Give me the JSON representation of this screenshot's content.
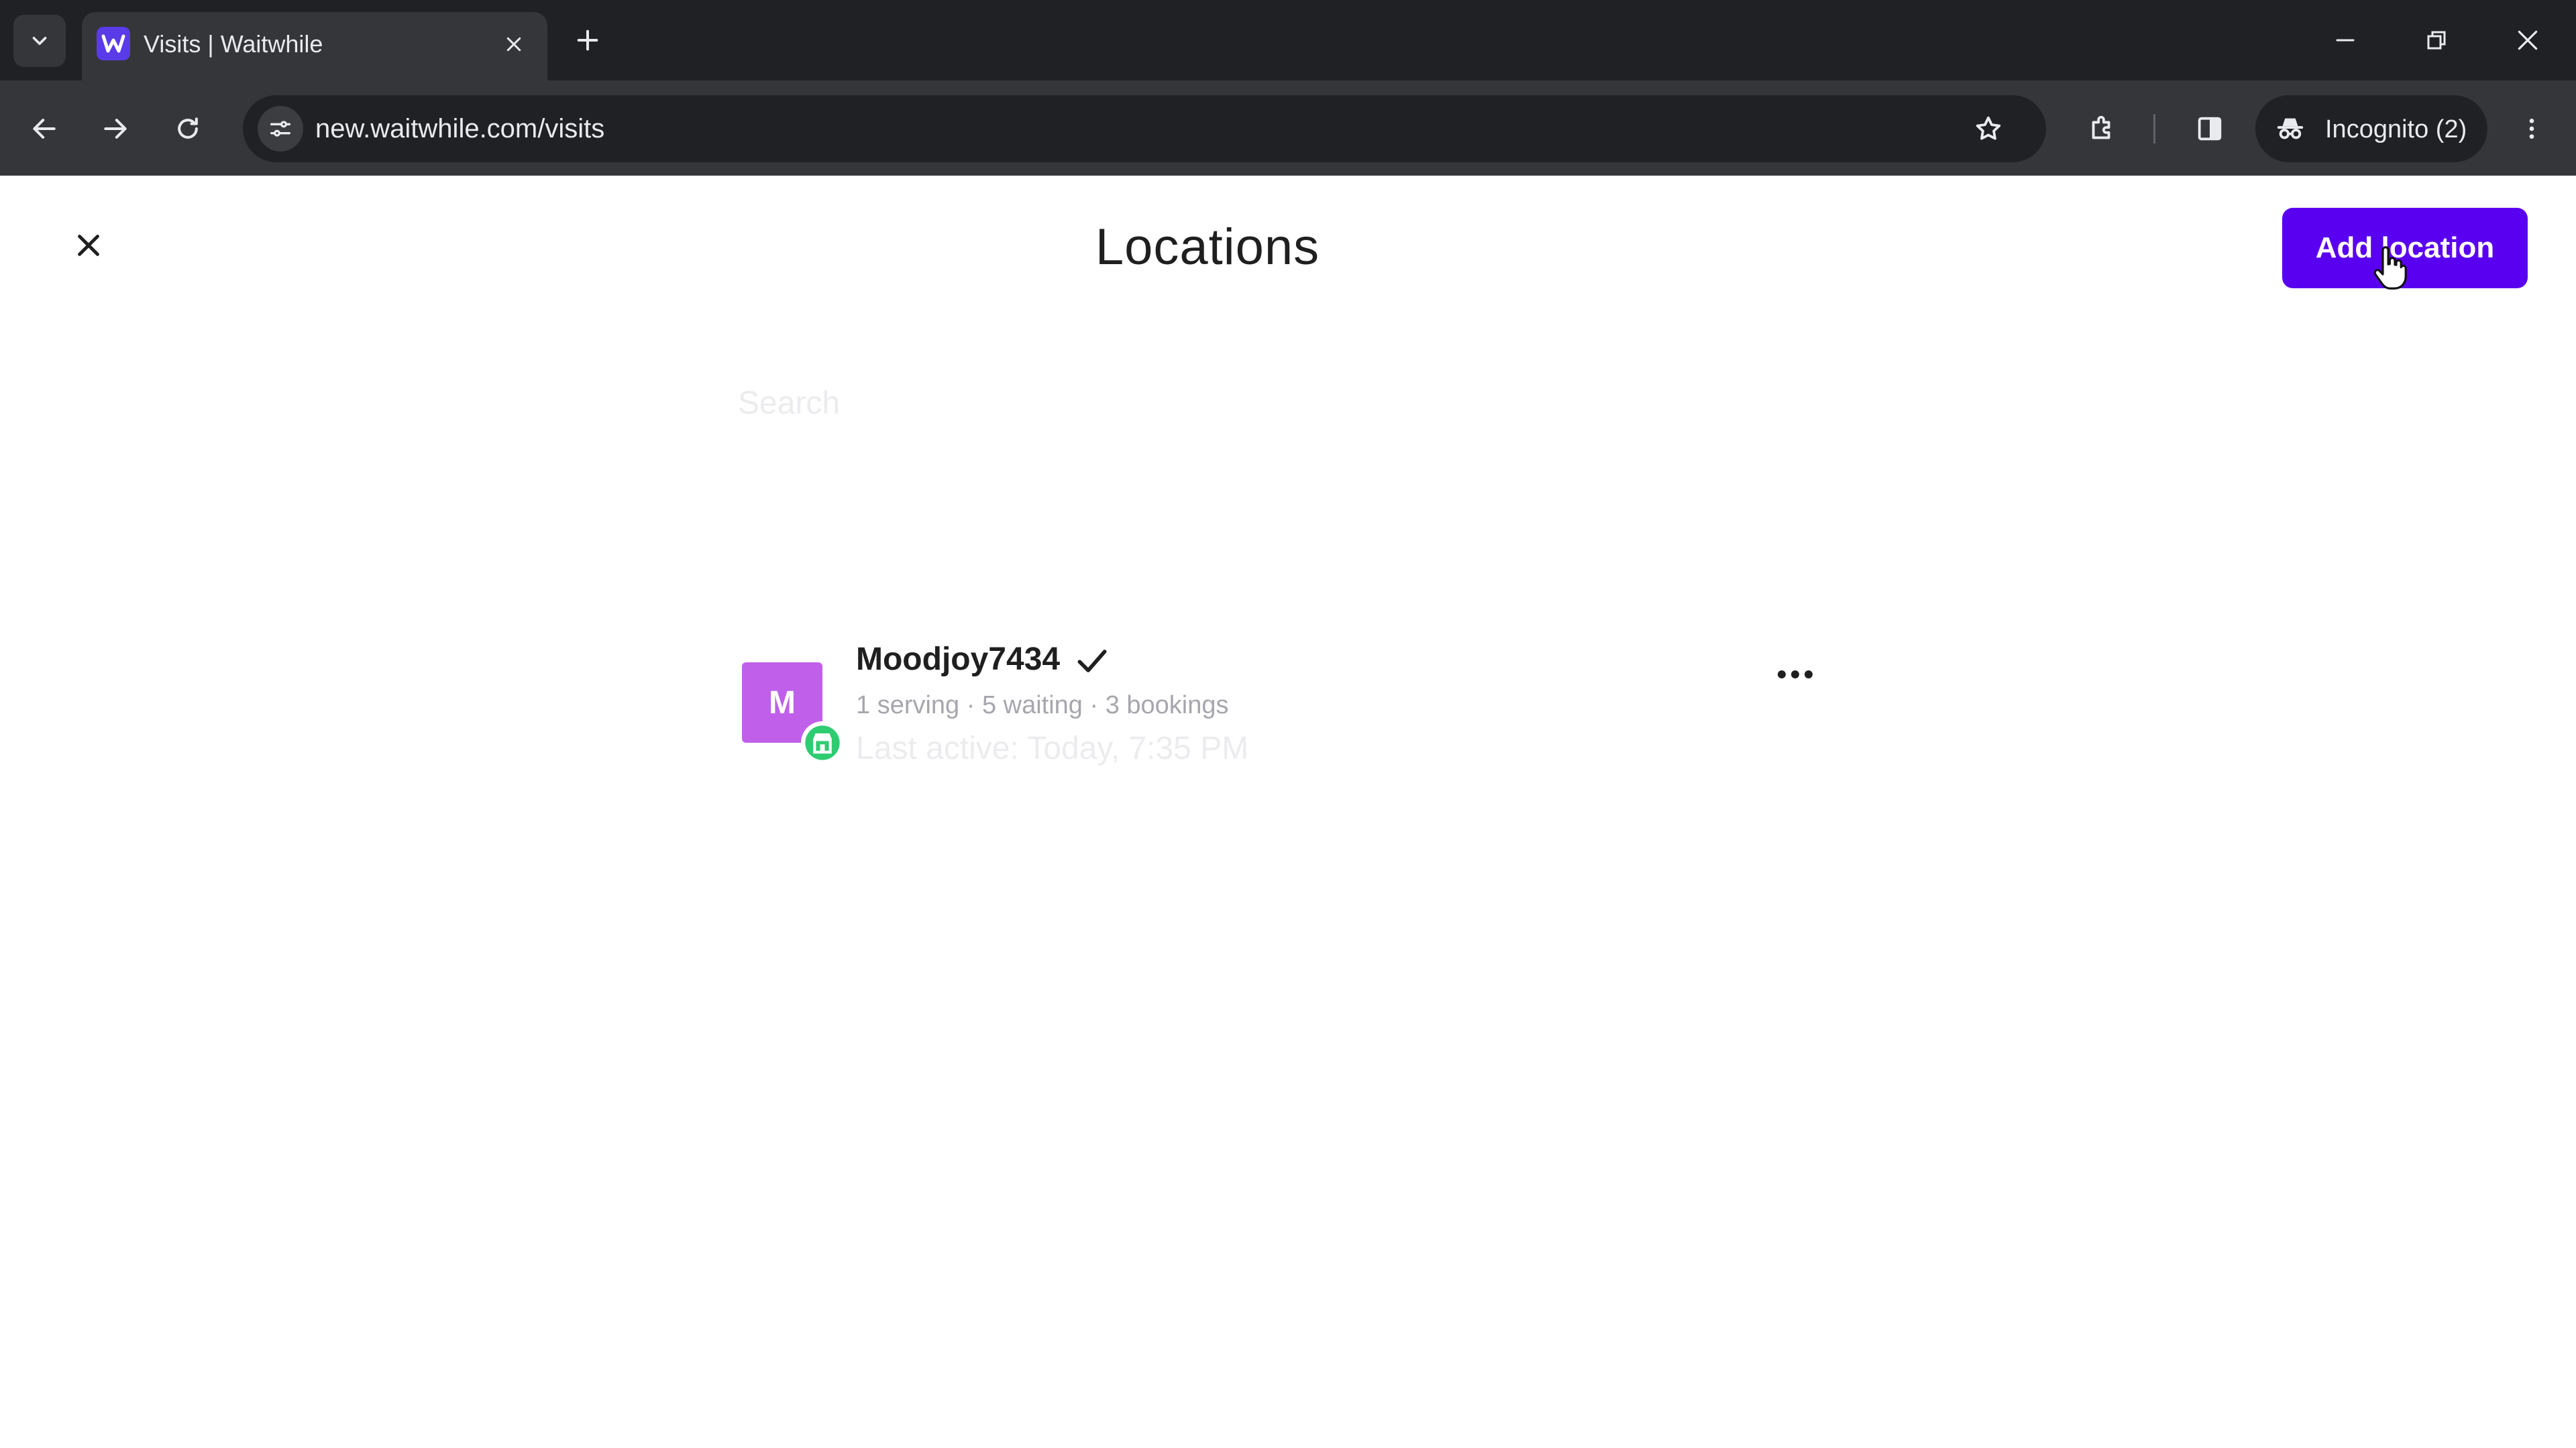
{
  "browser": {
    "tab": {
      "title": "Visits | Waitwhile",
      "favicon": "waitwhile-logo-icon"
    },
    "address_bar": {
      "url": "new.waitwhile.com/visits"
    },
    "profile": {
      "label": "Incognito (2)"
    }
  },
  "page": {
    "title": "Locations",
    "add_button_label": "Add location",
    "search": {
      "placeholder": "Search",
      "value": ""
    },
    "locations": [
      {
        "avatar_letter": "M",
        "name": "Moodjoy7434",
        "selected": true,
        "stats": "1 serving · 5 waiting · 3 bookings",
        "last_active": "Last active: Today, 7:35 PM",
        "status": "open"
      }
    ]
  },
  "colors": {
    "accent": "#5a00f0",
    "avatar": "#c060ea",
    "status_open": "#2ecc71",
    "chrome_dark": "#202124",
    "chrome_mid": "#35363a"
  }
}
